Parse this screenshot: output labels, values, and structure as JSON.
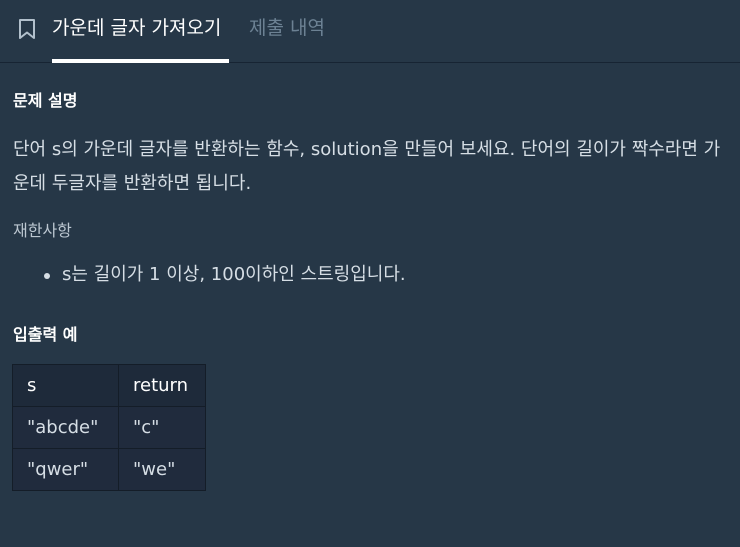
{
  "tabs": {
    "active": "가운데 글자 가져오기",
    "inactive": "제출 내역"
  },
  "problem": {
    "heading": "문제 설명",
    "description": "단어 s의 가운데 글자를 반환하는 함수, solution을 만들어 보세요. 단어의 길이가 짝수라면 가운데 두글자를 반환하면 됩니다.",
    "constraints_heading": "재한사항",
    "constraints": [
      "s는 길이가 1 이상, 100이하인 스트링입니다."
    ]
  },
  "examples": {
    "heading": "입출력 예",
    "columns": [
      "s",
      "return"
    ],
    "rows": [
      [
        "\"abcde\"",
        "\"c\""
      ],
      [
        "\"qwer\"",
        "\"we\""
      ]
    ]
  }
}
